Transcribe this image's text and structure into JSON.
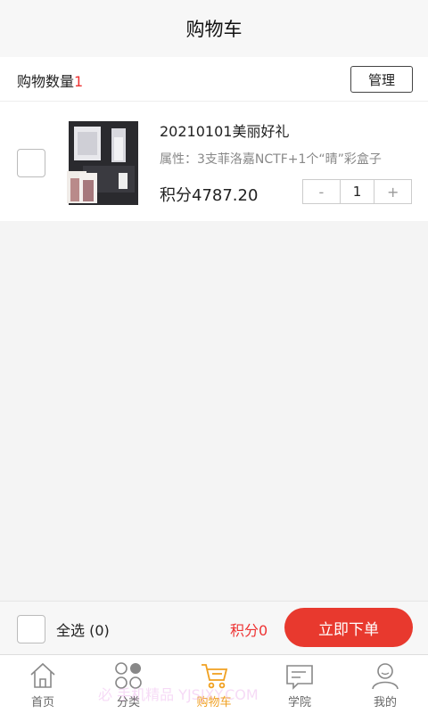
{
  "header": {
    "title": "购物车"
  },
  "count_bar": {
    "label": "购物数量",
    "count": "1",
    "manage_label": "管理"
  },
  "cart_items": [
    {
      "name": "20210101美丽好礼",
      "attributes": "属性：3支菲洛嘉NCTF+1个“晴”彩盒子",
      "price": "积分4787.20",
      "quantity": "1",
      "minus": "-",
      "plus": "+"
    }
  ],
  "footer": {
    "select_all": "全选 (0)",
    "total": "积分0",
    "order_button": "立即下单"
  },
  "tabs": [
    {
      "label": "首页",
      "icon": "home-icon"
    },
    {
      "label": "分类",
      "icon": "category-icon"
    },
    {
      "label": "购物车",
      "icon": "cart-icon",
      "active": true
    },
    {
      "label": "学院",
      "icon": "academy-icon"
    },
    {
      "label": "我的",
      "icon": "profile-icon"
    }
  ],
  "watermark": "必 手机精品 YJSJXY.COM",
  "colors": {
    "accent_red": "#e8392e",
    "active_tab": "#f0a020"
  }
}
